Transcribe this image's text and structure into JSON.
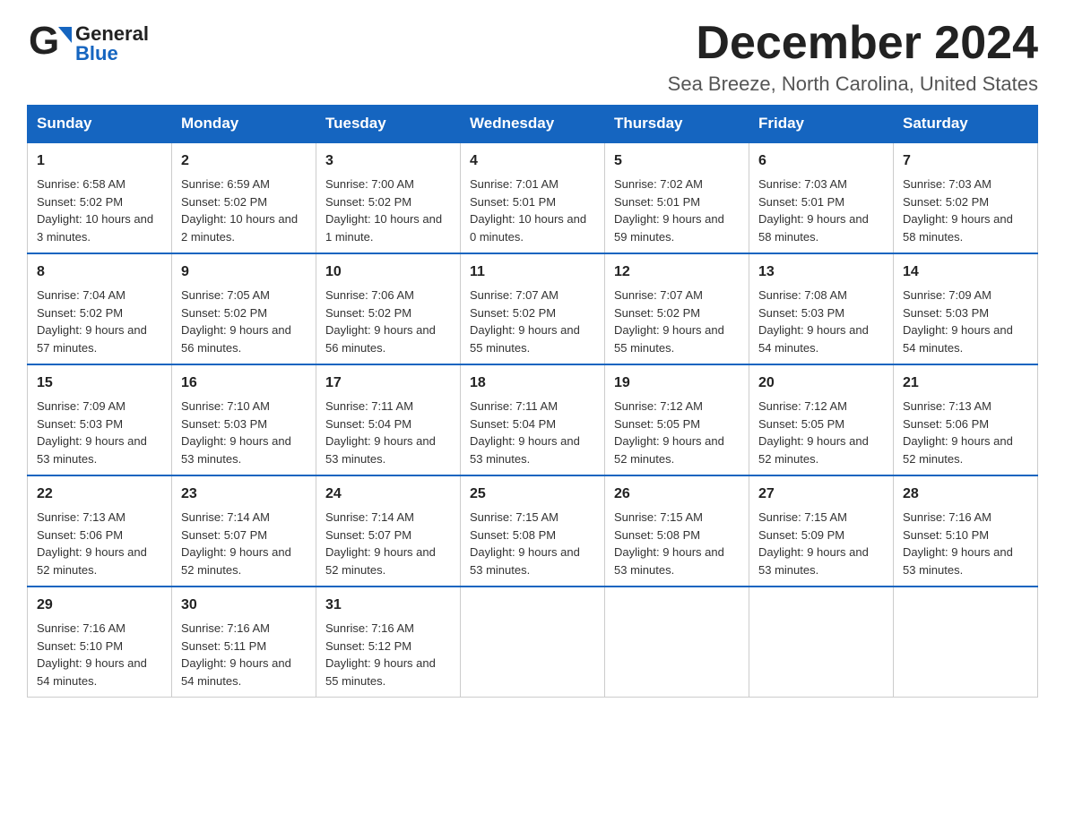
{
  "header": {
    "logo_general": "General",
    "logo_blue": "Blue",
    "month_title": "December 2024",
    "location": "Sea Breeze, North Carolina, United States"
  },
  "days_of_week": [
    "Sunday",
    "Monday",
    "Tuesday",
    "Wednesday",
    "Thursday",
    "Friday",
    "Saturday"
  ],
  "weeks": [
    [
      {
        "day": "1",
        "sunrise": "6:58 AM",
        "sunset": "5:02 PM",
        "daylight": "10 hours and 3 minutes."
      },
      {
        "day": "2",
        "sunrise": "6:59 AM",
        "sunset": "5:02 PM",
        "daylight": "10 hours and 2 minutes."
      },
      {
        "day": "3",
        "sunrise": "7:00 AM",
        "sunset": "5:02 PM",
        "daylight": "10 hours and 1 minute."
      },
      {
        "day": "4",
        "sunrise": "7:01 AM",
        "sunset": "5:01 PM",
        "daylight": "10 hours and 0 minutes."
      },
      {
        "day": "5",
        "sunrise": "7:02 AM",
        "sunset": "5:01 PM",
        "daylight": "9 hours and 59 minutes."
      },
      {
        "day": "6",
        "sunrise": "7:03 AM",
        "sunset": "5:01 PM",
        "daylight": "9 hours and 58 minutes."
      },
      {
        "day": "7",
        "sunrise": "7:03 AM",
        "sunset": "5:02 PM",
        "daylight": "9 hours and 58 minutes."
      }
    ],
    [
      {
        "day": "8",
        "sunrise": "7:04 AM",
        "sunset": "5:02 PM",
        "daylight": "9 hours and 57 minutes."
      },
      {
        "day": "9",
        "sunrise": "7:05 AM",
        "sunset": "5:02 PM",
        "daylight": "9 hours and 56 minutes."
      },
      {
        "day": "10",
        "sunrise": "7:06 AM",
        "sunset": "5:02 PM",
        "daylight": "9 hours and 56 minutes."
      },
      {
        "day": "11",
        "sunrise": "7:07 AM",
        "sunset": "5:02 PM",
        "daylight": "9 hours and 55 minutes."
      },
      {
        "day": "12",
        "sunrise": "7:07 AM",
        "sunset": "5:02 PM",
        "daylight": "9 hours and 55 minutes."
      },
      {
        "day": "13",
        "sunrise": "7:08 AM",
        "sunset": "5:03 PM",
        "daylight": "9 hours and 54 minutes."
      },
      {
        "day": "14",
        "sunrise": "7:09 AM",
        "sunset": "5:03 PM",
        "daylight": "9 hours and 54 minutes."
      }
    ],
    [
      {
        "day": "15",
        "sunrise": "7:09 AM",
        "sunset": "5:03 PM",
        "daylight": "9 hours and 53 minutes."
      },
      {
        "day": "16",
        "sunrise": "7:10 AM",
        "sunset": "5:03 PM",
        "daylight": "9 hours and 53 minutes."
      },
      {
        "day": "17",
        "sunrise": "7:11 AM",
        "sunset": "5:04 PM",
        "daylight": "9 hours and 53 minutes."
      },
      {
        "day": "18",
        "sunrise": "7:11 AM",
        "sunset": "5:04 PM",
        "daylight": "9 hours and 53 minutes."
      },
      {
        "day": "19",
        "sunrise": "7:12 AM",
        "sunset": "5:05 PM",
        "daylight": "9 hours and 52 minutes."
      },
      {
        "day": "20",
        "sunrise": "7:12 AM",
        "sunset": "5:05 PM",
        "daylight": "9 hours and 52 minutes."
      },
      {
        "day": "21",
        "sunrise": "7:13 AM",
        "sunset": "5:06 PM",
        "daylight": "9 hours and 52 minutes."
      }
    ],
    [
      {
        "day": "22",
        "sunrise": "7:13 AM",
        "sunset": "5:06 PM",
        "daylight": "9 hours and 52 minutes."
      },
      {
        "day": "23",
        "sunrise": "7:14 AM",
        "sunset": "5:07 PM",
        "daylight": "9 hours and 52 minutes."
      },
      {
        "day": "24",
        "sunrise": "7:14 AM",
        "sunset": "5:07 PM",
        "daylight": "9 hours and 52 minutes."
      },
      {
        "day": "25",
        "sunrise": "7:15 AM",
        "sunset": "5:08 PM",
        "daylight": "9 hours and 53 minutes."
      },
      {
        "day": "26",
        "sunrise": "7:15 AM",
        "sunset": "5:08 PM",
        "daylight": "9 hours and 53 minutes."
      },
      {
        "day": "27",
        "sunrise": "7:15 AM",
        "sunset": "5:09 PM",
        "daylight": "9 hours and 53 minutes."
      },
      {
        "day": "28",
        "sunrise": "7:16 AM",
        "sunset": "5:10 PM",
        "daylight": "9 hours and 53 minutes."
      }
    ],
    [
      {
        "day": "29",
        "sunrise": "7:16 AM",
        "sunset": "5:10 PM",
        "daylight": "9 hours and 54 minutes."
      },
      {
        "day": "30",
        "sunrise": "7:16 AM",
        "sunset": "5:11 PM",
        "daylight": "9 hours and 54 minutes."
      },
      {
        "day": "31",
        "sunrise": "7:16 AM",
        "sunset": "5:12 PM",
        "daylight": "9 hours and 55 minutes."
      },
      null,
      null,
      null,
      null
    ]
  ]
}
